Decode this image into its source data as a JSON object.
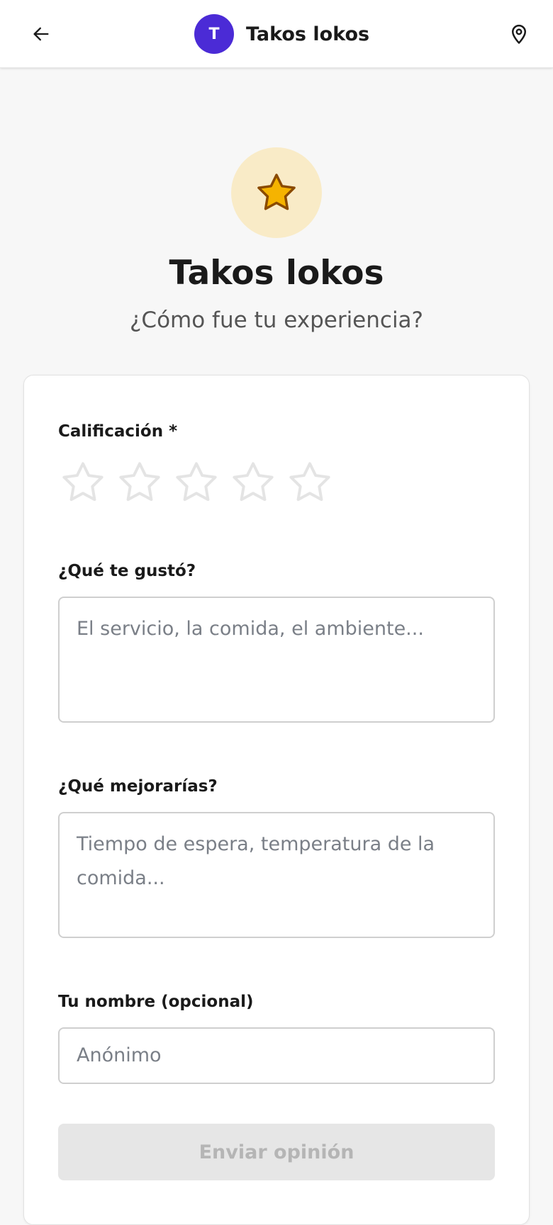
{
  "header": {
    "avatar_letter": "T",
    "restaurant_name": "Takos lokos",
    "back_icon": "arrow-left-icon",
    "location_icon": "map-pin-icon"
  },
  "hero": {
    "icon": "star-icon",
    "title": "Takos lokos",
    "subtitle": "¿Cómo fue tu experiencia?"
  },
  "form": {
    "rating_label": "Calificación *",
    "rating_value": 0,
    "rating_max": 5,
    "liked_label": "¿Qué te gustó?",
    "liked_placeholder": "El servicio, la comida, el ambiente...",
    "improve_label": "¿Qué mejorarías?",
    "improve_placeholder": "Tiempo de espera, temperatura de la comida...",
    "name_label": "Tu nombre (opcional)",
    "name_placeholder": "Anónimo",
    "submit_label": "Enviar opinión"
  },
  "colors": {
    "brand": "#4b2bd6",
    "star_fill": "#f5b301",
    "star_badge_bg": "#f9ebc7",
    "disabled_bg": "#e6e6e6"
  }
}
